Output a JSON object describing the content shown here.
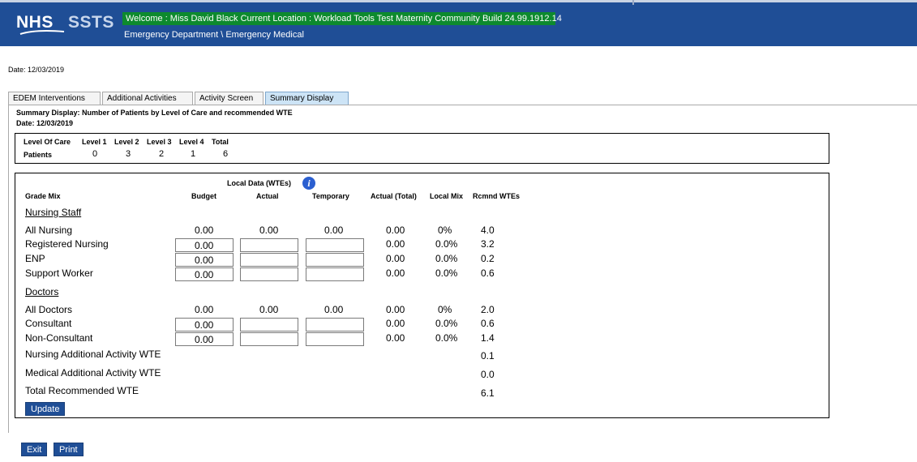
{
  "header": {
    "logo_nhs": "NHS",
    "logo_ssts": "SSTS",
    "welcome": "Welcome : Miss David Black Current Location : Workload Tools Test Maternity Community Build 24.99.1912.14",
    "sublocation": "Emergency Department \\ Emergency Medical",
    "colors": {
      "header_bg": "#1f4e96",
      "welcome_bg": "#0d8a2e"
    }
  },
  "date_line": "Date: 12/03/2019",
  "tabs": [
    {
      "label": "EDEM Interventions",
      "active": false
    },
    {
      "label": "Additional Activities",
      "active": false
    },
    {
      "label": "Activity Screen",
      "active": false
    },
    {
      "label": "Summary Display",
      "active": true
    }
  ],
  "summary": {
    "title": "Summary Display: Number of Patients by Level of Care and recommended WTE",
    "date": "Date: 12/03/2019"
  },
  "levels": {
    "headers": [
      "Level Of Care",
      "Level 1",
      "Level 2",
      "Level 3",
      "Level 4",
      "Total"
    ],
    "row_label": "Patients",
    "values": [
      "0",
      "3",
      "2",
      "1",
      "6"
    ]
  },
  "grid": {
    "local_data_label": "Local Data (WTEs)",
    "info_icon": "info-icon",
    "headers": {
      "grade_mix": "Grade Mix",
      "budget": "Budget",
      "actual": "Actual",
      "temporary": "Temporary",
      "actual_total": "Actual (Total)",
      "local_mix": "Local Mix",
      "rcmnd": "Rcmnd WTEs"
    },
    "nursing_section": "Nursing Staff",
    "doctors_section": "Doctors",
    "all_nursing": {
      "label": "All Nursing",
      "budget": "0.00",
      "actual": "0.00",
      "temporary": "0.00",
      "actual_total": "0.00",
      "local_mix": "0%",
      "rcmnd": "4.0"
    },
    "registered_nursing": {
      "label": "Registered Nursing",
      "budget": "0.00",
      "actual": "",
      "temporary": "",
      "actual_total": "0.00",
      "local_mix": "0.0%",
      "rcmnd": "3.2"
    },
    "enp": {
      "label": "ENP",
      "budget": "0.00",
      "actual": "",
      "temporary": "",
      "actual_total": "0.00",
      "local_mix": "0.0%",
      "rcmnd": "0.2"
    },
    "support_worker": {
      "label": "Support Worker",
      "budget": "0.00",
      "actual": "",
      "temporary": "",
      "actual_total": "0.00",
      "local_mix": "0.0%",
      "rcmnd": "0.6"
    },
    "all_doctors": {
      "label": "All Doctors",
      "budget": "0.00",
      "actual": "0.00",
      "temporary": "0.00",
      "actual_total": "0.00",
      "local_mix": "0%",
      "rcmnd": "2.0"
    },
    "consultant": {
      "label": "Consultant",
      "budget": "0.00",
      "actual": "",
      "temporary": "",
      "actual_total": "0.00",
      "local_mix": "0.0%",
      "rcmnd": "0.6"
    },
    "non_consultant": {
      "label": "Non-Consultant",
      "budget": "0.00",
      "actual": "",
      "temporary": "",
      "actual_total": "0.00",
      "local_mix": "0.0%",
      "rcmnd": "1.4"
    },
    "nursing_additional": {
      "label": "Nursing Additional Activity WTE",
      "rcmnd": "0.1"
    },
    "medical_additional": {
      "label": "Medical Additional Activity WTE",
      "rcmnd": "0.0"
    },
    "total_recommended": {
      "label": "Total Recommended WTE",
      "rcmnd": "6.1"
    },
    "update_label": "Update"
  },
  "footer": {
    "exit_label": "Exit",
    "print_label": "Print"
  }
}
